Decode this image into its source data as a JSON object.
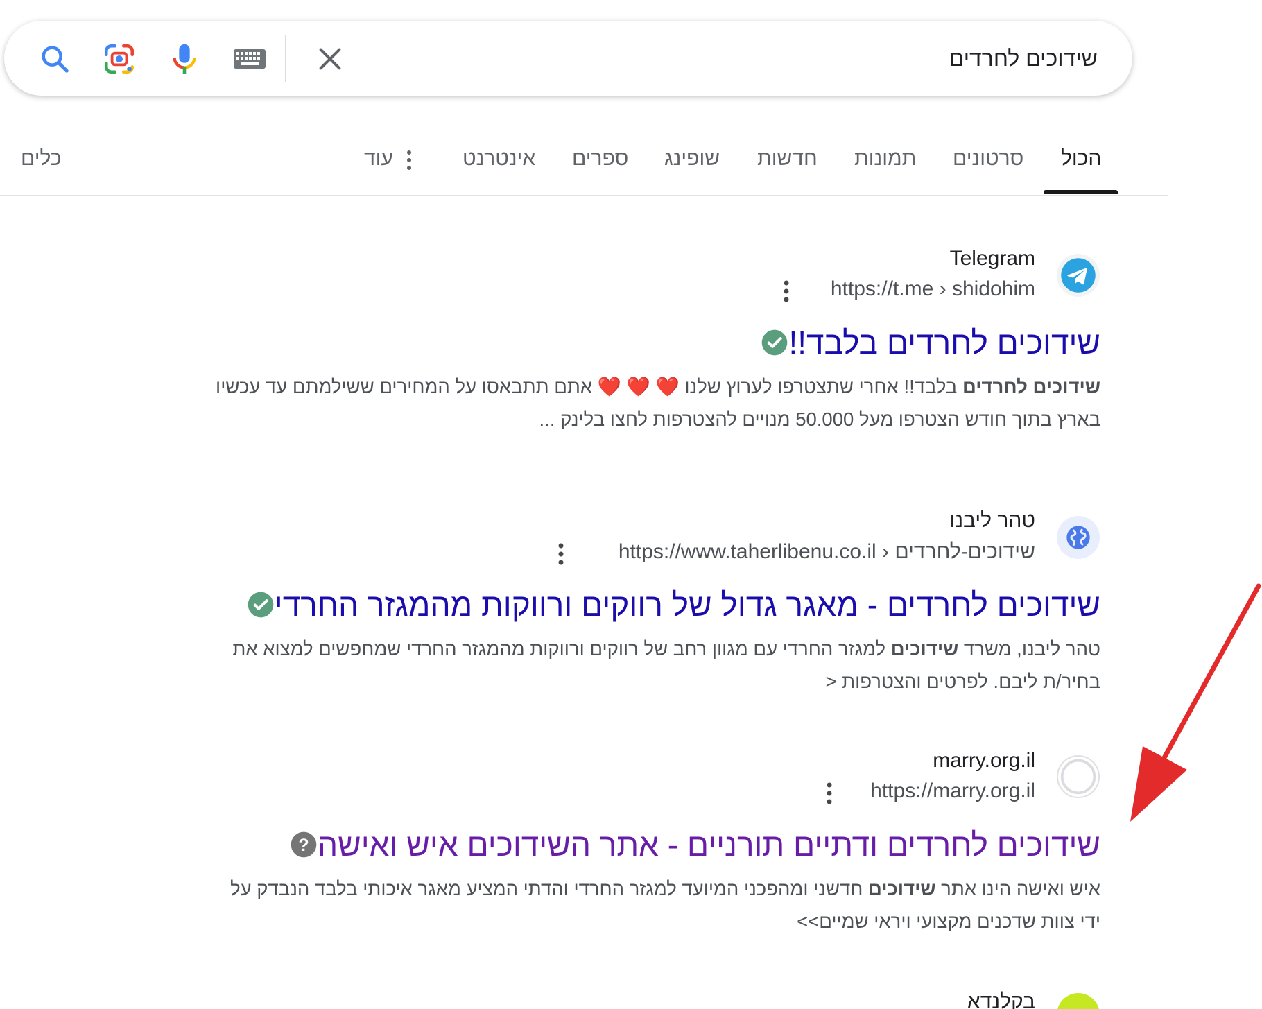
{
  "search": {
    "query": "שידוכים לחרדים"
  },
  "icons": {
    "search": "search-icon",
    "lens": "google-lens-icon",
    "mic": "microphone-icon",
    "keyboard": "keyboard-icon",
    "clear": "close-icon"
  },
  "tabs": {
    "all": "הכול",
    "videos": "סרטונים",
    "images": "תמונות",
    "news": "חדשות",
    "shopping": "שופינג",
    "books": "ספרים",
    "web": "אינטרנט",
    "more": "עוד",
    "tools": "כלים"
  },
  "results": [
    {
      "site_name": "Telegram",
      "url": "https://t.me › shidohim",
      "title": "שידוכים לחרדים בלבד!!",
      "badge": "verified-check-icon",
      "snippet_bold_1": "שידוכים לחרדים",
      "snippet_line1_rest": " בלבד!! אחרי שתצטרפו לערוץ שלנו ❤️ ❤️ ❤️ אתם תתבאסו על המחירים ששילמתם עד עכשיו",
      "snippet_line2": "בארץ בתוך חודש הצטרפו מעל 50.000 מנויים להצטרפות לחצו בלינק ..."
    },
    {
      "site_name": "טהר ליבנו",
      "url": "https://www.taherlibenu.co.il › שידוכים-לחרדים",
      "title": "שידוכים לחרדים - מאגר גדול של רווקים ורווקות מהמגזר החרדי",
      "badge": "verified-check-icon",
      "snippet_line1_pre": "טהר ליבנו, משרד ",
      "snippet_bold_1": "שידוכים",
      "snippet_line1_rest": " למגזר החרדי עם מגוון רחב של רווקים ורווקות מהמגזר החרדי שמחפשים למצוא את",
      "snippet_line2": "בחיר/ת ליבם. לפרטים והצטרפות <"
    },
    {
      "site_name": "marry.org.il",
      "url": "https://marry.org.il",
      "title": "שידוכים לחרדים ודתיים תורניים - אתר השידוכים איש ואישה",
      "badge": "question-mark-icon",
      "snippet_line1_pre": "איש ואישה הינו אתר ",
      "snippet_bold_1": "שידוכים",
      "snippet_line1_rest": " חדשני ומהפכני המיועד למגזר החרדי והדתי המציע מאגר איכותי בלבד הנבדק על",
      "snippet_line2": "ידי צוות שדכנים מקצועי ויראי שמיים>>"
    },
    {
      "site_name": "בקלנדא"
    }
  ],
  "colors": {
    "link_blue": "#1a0dab",
    "link_visited": "#681da8",
    "verified_green": "#5b9e7d",
    "annotation_arrow": "#e32b2b"
  }
}
